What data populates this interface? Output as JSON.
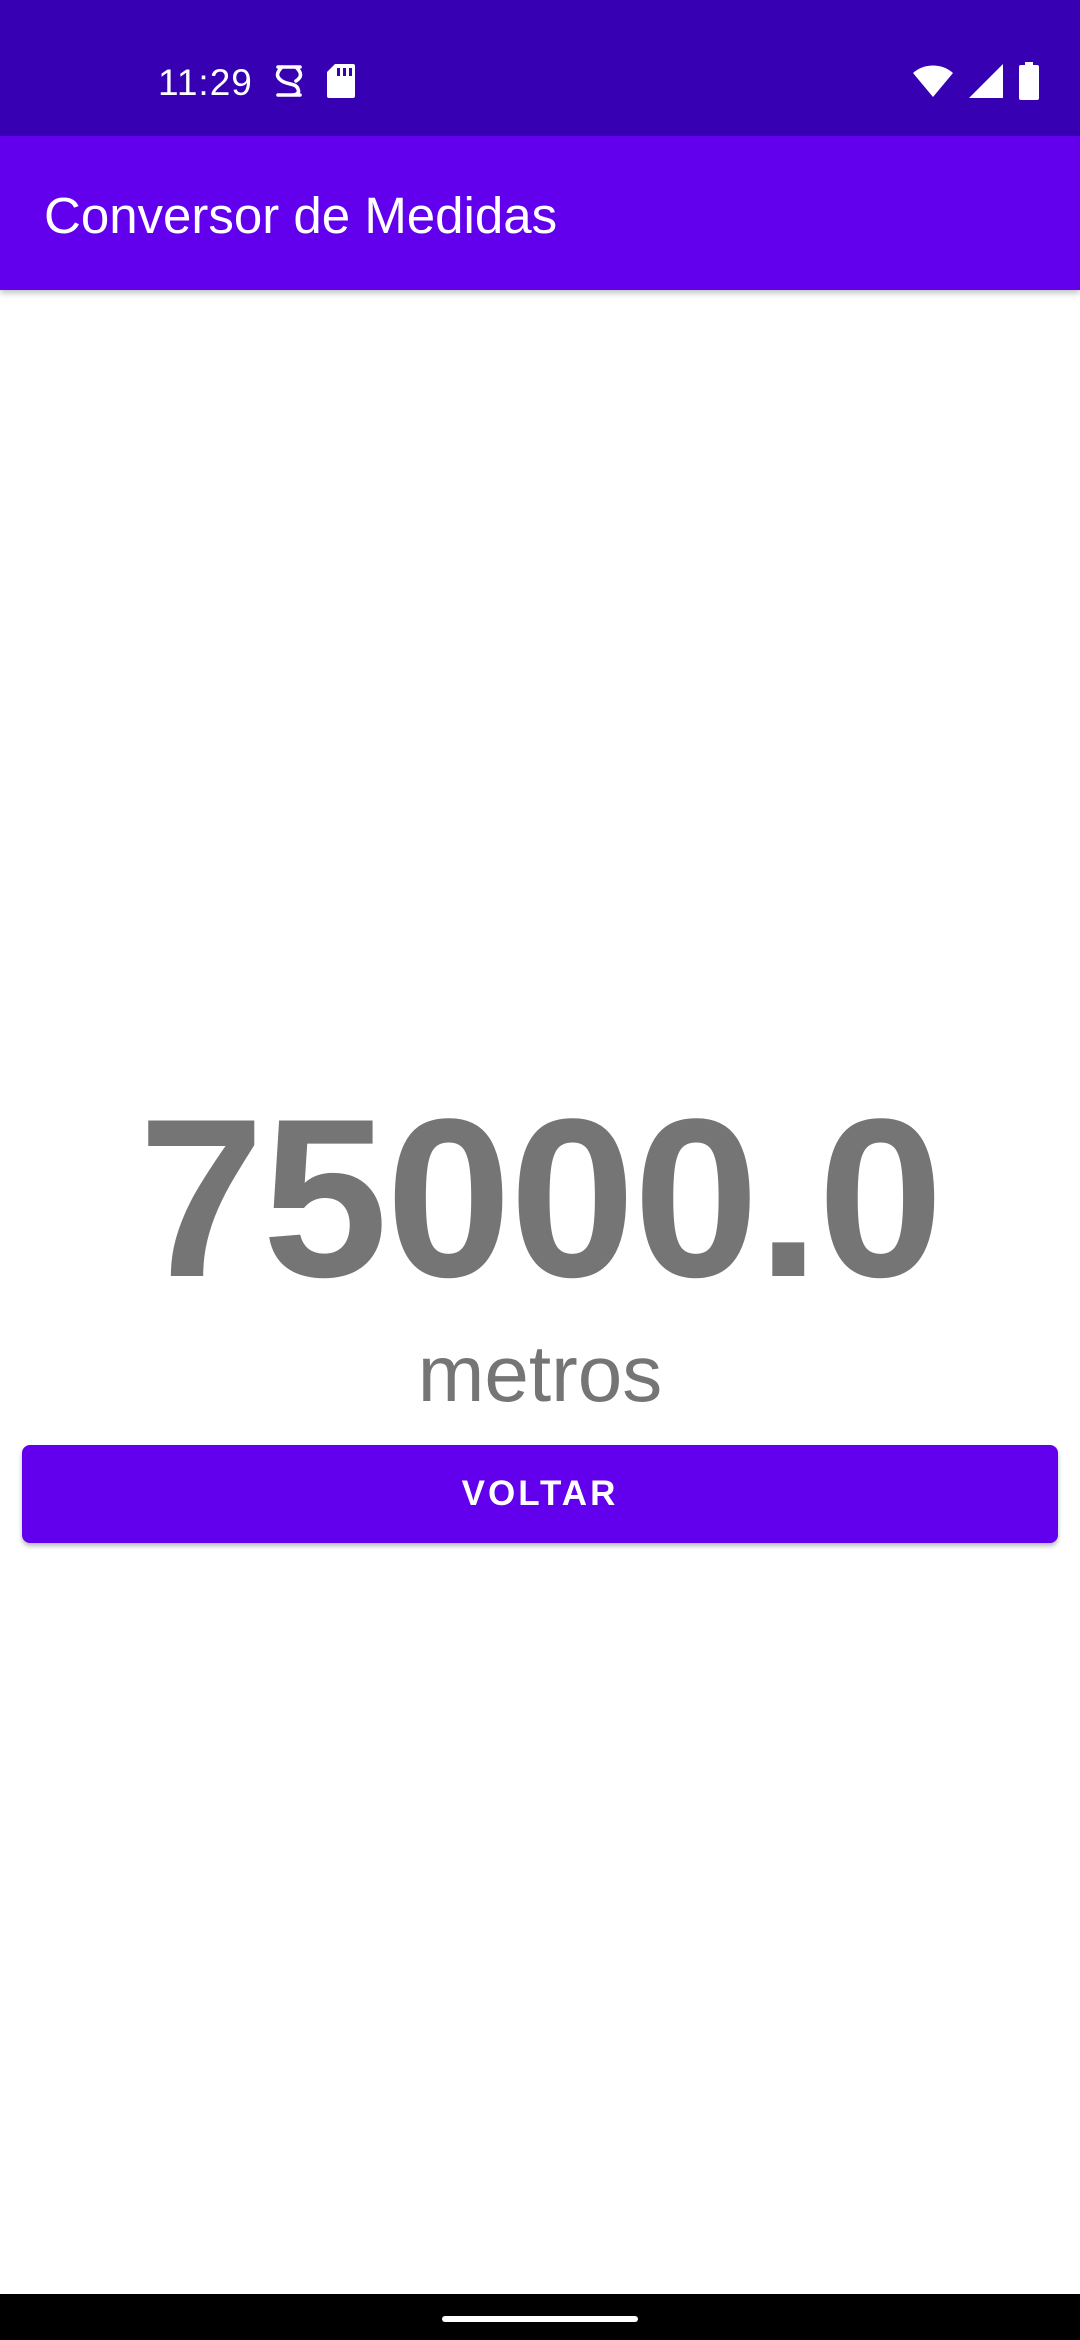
{
  "status_bar": {
    "time": "11:29",
    "icons": [
      "debug-icon",
      "sd-card-icon",
      "wifi-icon",
      "cellular-signal-icon",
      "battery-icon"
    ],
    "background_color": "#3700b3"
  },
  "app_bar": {
    "title": "Conversor de Medidas",
    "background_color": "#6200ee"
  },
  "result": {
    "value": "75000.0",
    "unit": "metros",
    "text_color": "#757575"
  },
  "actions": {
    "back_label": "VOLTAR",
    "button_color": "#6200ee"
  }
}
